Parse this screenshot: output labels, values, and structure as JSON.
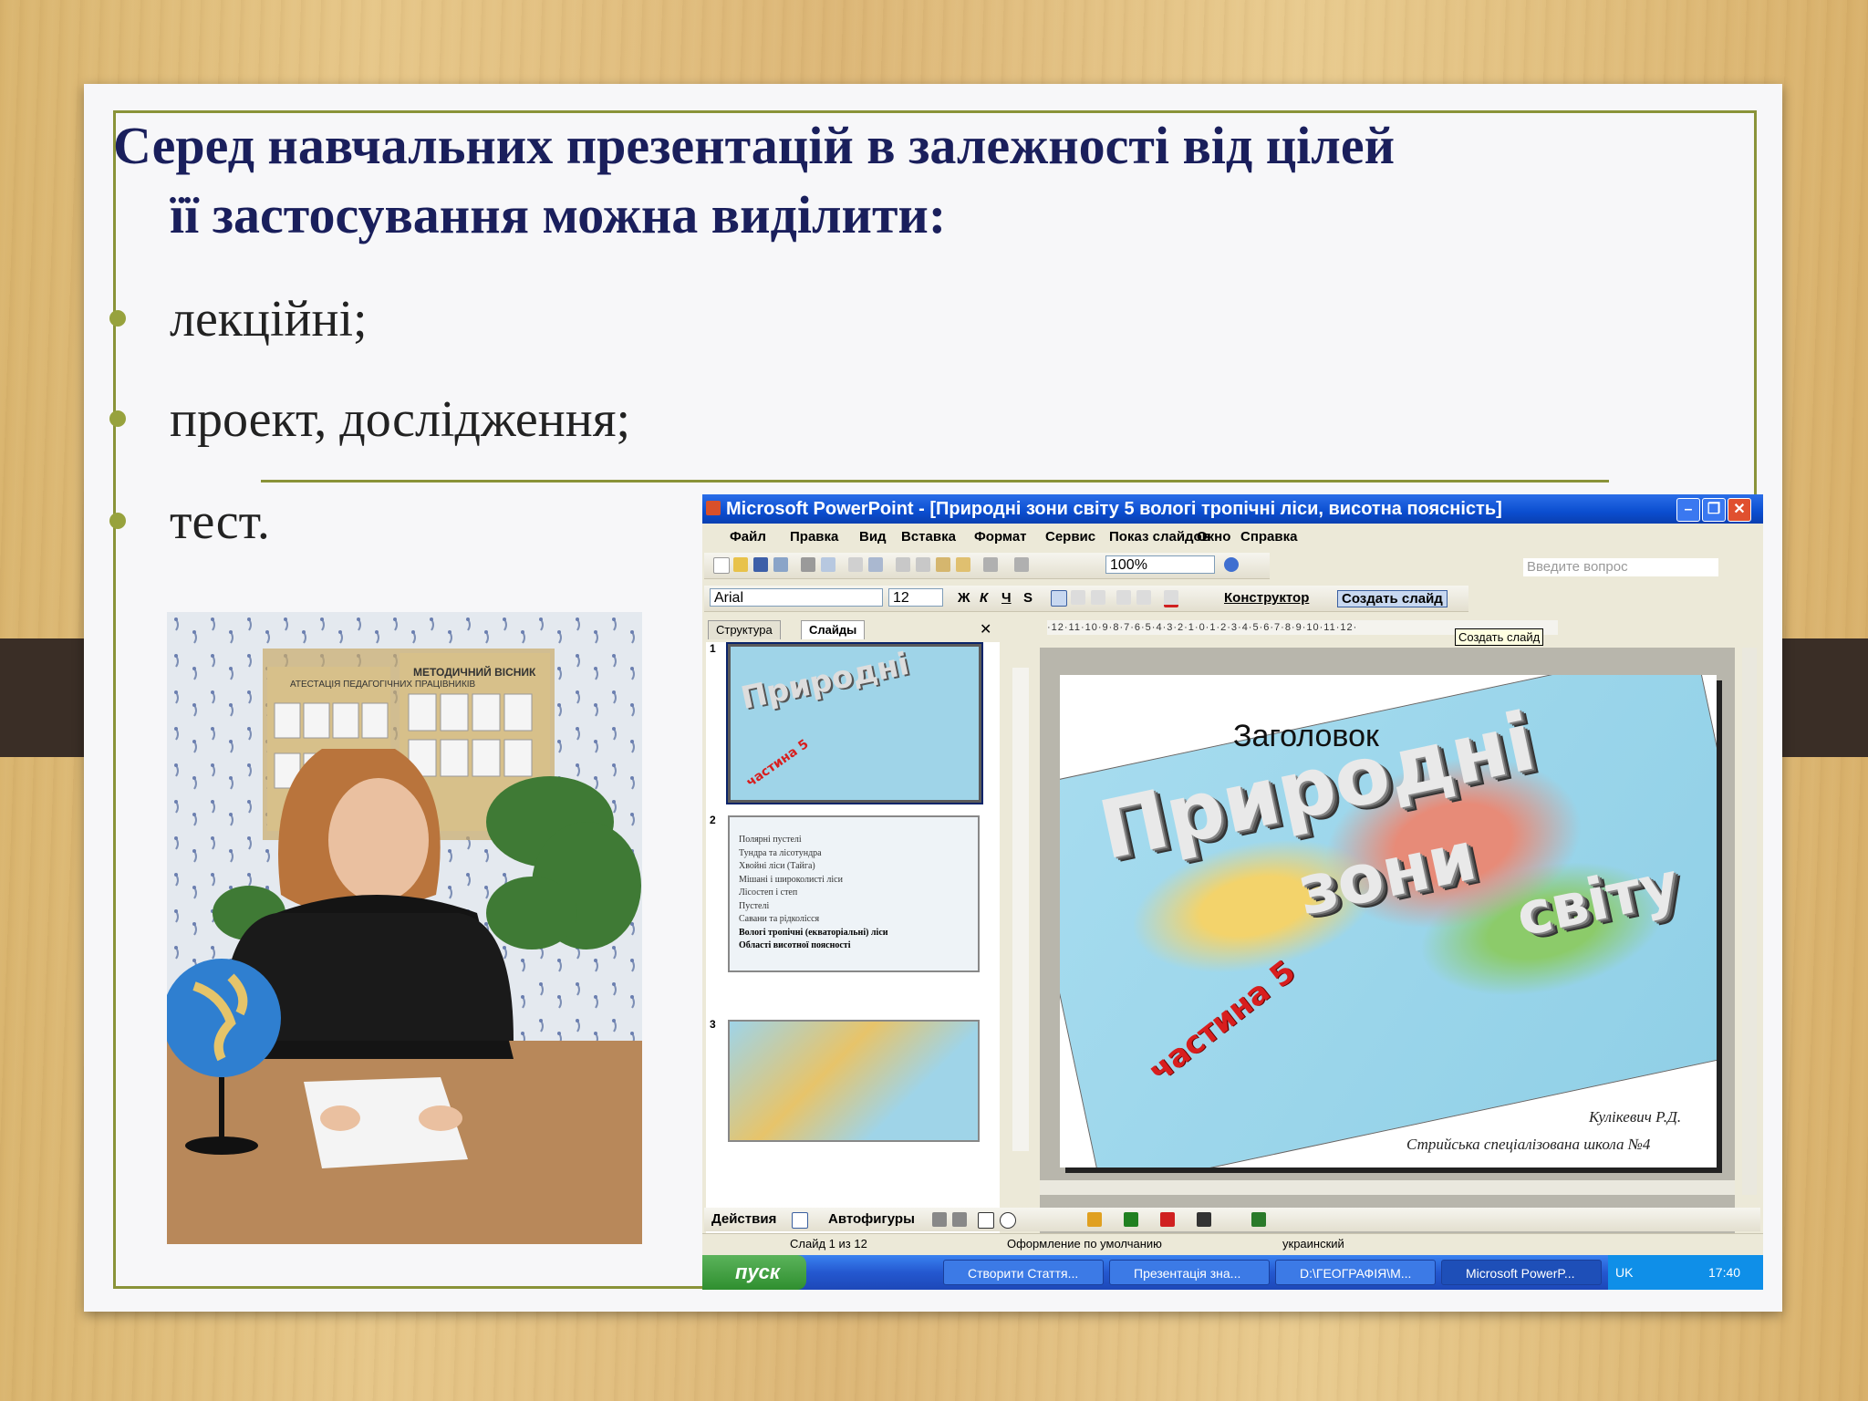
{
  "slide": {
    "title_line1": "Серед навчальних презентацій в залежності від цілей",
    "title_line2": "її застосування можна виділити:",
    "bullets": [
      "лекційні;",
      "проект, дослідження;",
      "тест."
    ]
  },
  "screenshot": {
    "window_title": "Microsoft PowerPoint - [Природні зони світу 5 вологі тропічні ліси, висотна поясність]",
    "menu": [
      "Файл",
      "Правка",
      "Вид",
      "Вставка",
      "Формат",
      "Сервис",
      "Показ слайдов",
      "Окно",
      "Справка"
    ],
    "ask_placeholder": "Введите вопрос",
    "zoom": "100%",
    "font_name": "Arial",
    "font_size": "12",
    "designer_label": "Конструктор",
    "new_slide_label": "Создать слайд",
    "tooltip": "Создать слайд",
    "panel_tabs": [
      "Структура",
      "Слайды"
    ],
    "panel_close": "✕",
    "ruler_text": "·12·11·10·9·8·7·6·5·4·3·2·1·0·1·2·3·4·5·6·7·8·9·10·11·12·",
    "thumb_numbers": [
      "1",
      "2",
      "3"
    ],
    "thumb2_items": [
      "Полярні пустелі",
      "Тундра та лісотундра",
      "Хвойні ліси (Тайга)",
      "Мішані і широколисті ліси",
      "Лісостеп і степ",
      "Пустелі",
      "Савани та рідколісся",
      "Вологі тропічні (екваторіальні) ліси",
      "Області висотної поясності"
    ],
    "slide_placeholder": "Заголовок",
    "wordart": [
      "Природні",
      "зони",
      "світу"
    ],
    "part_label": "частина 5",
    "author": "Кулікевич Р.Д.",
    "school": "Стрийська спеціалізована школа №4",
    "draw_actions": "Действия",
    "draw_autoshapes": "Автофигуры",
    "status": {
      "slide_of": "Слайд 1 из 12",
      "design": "Оформление по умолчанию",
      "language": "украинский"
    },
    "start_label": "пуск",
    "tasks": [
      "Створити Стаття...",
      "Презентація зна...",
      "D:\\ГЕОГРАФІЯ\\М...",
      "Microsoft PowerP..."
    ],
    "tray_lang": "UK",
    "clock": "17:40"
  },
  "photo_posters": [
    "АТЕСТАЦІЯ ПЕДАГОГІЧНИХ ПРАЦІВНИКІВ",
    "МЕТОДИЧНИЙ ВІСНИК"
  ],
  "colors": {
    "title": "#1a1f5c",
    "accent": "#8a9339",
    "xp_blue": "#0b4ed0"
  }
}
